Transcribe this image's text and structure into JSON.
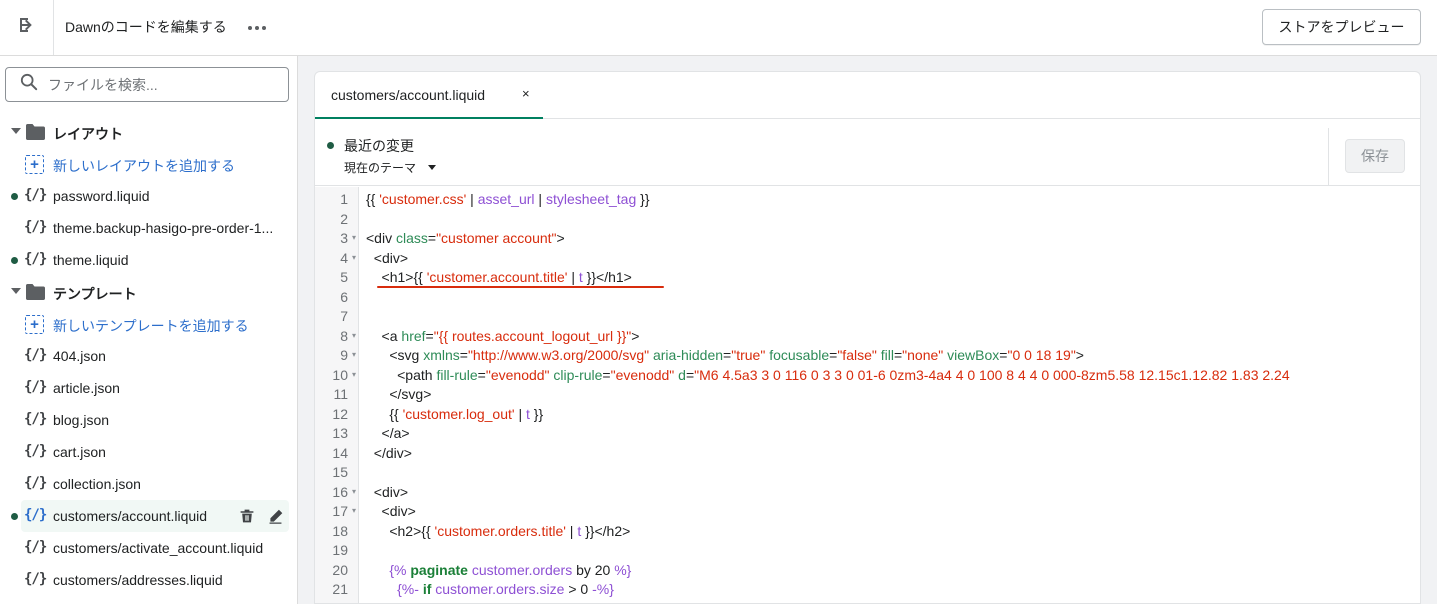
{
  "header": {
    "title": "Dawnのコードを編集する",
    "preview_label": "ストアをプレビュー"
  },
  "sidebar": {
    "search_placeholder": "ファイルを検索...",
    "layout_folder": "レイアウト",
    "layout_add": "新しいレイアウトを追加する",
    "layout_files": [
      "password.liquid",
      "theme.backup-hasigo-pre-order-1...",
      "theme.liquid"
    ],
    "template_folder": "テンプレート",
    "template_add": "新しいテンプレートを追加する",
    "template_files": [
      "404.json",
      "article.json",
      "blog.json",
      "cart.json",
      "collection.json",
      "customers/account.liquid",
      "customers/activate_account.liquid",
      "customers/addresses.liquid"
    ],
    "code_icon": "{/}"
  },
  "editor": {
    "tab_label": "customers/account.liquid",
    "close_glyph": "×",
    "version_title": "最近の変更",
    "version_select": "現在のテーマ",
    "save_label": "保存",
    "line_numbers": [
      "1",
      "2",
      "3",
      "4",
      "5",
      "6",
      "7",
      "8",
      "9",
      "10",
      "11",
      "12",
      "13",
      "14",
      "15",
      "16",
      "17",
      "18",
      "19",
      "20",
      "21"
    ]
  },
  "icons": {
    "exit": "exit-icon",
    "more": "more-horizontal-icon",
    "search": "search-icon",
    "folder": "folder-icon",
    "add": "add-file-icon",
    "delete": "trash-icon",
    "edit": "pencil-icon"
  },
  "colors": {
    "accent_green": "#008060",
    "link_blue": "#2c6ecb",
    "code_string": "#d82c0d",
    "code_filter": "#8e50d4",
    "code_attr": "#2e8b57"
  }
}
